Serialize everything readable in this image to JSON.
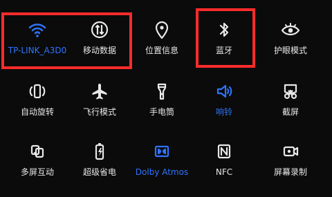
{
  "colors": {
    "background": "#0b0b0b",
    "text": "#e8e8e8",
    "active": "#2f74ff",
    "highlight": "#ff2b2b"
  },
  "tiles": [
    {
      "label": "TP-LINK_A3D0",
      "icon": "wifi-icon",
      "active": true
    },
    {
      "label": "移动数据",
      "icon": "mobile-data-icon",
      "active": false
    },
    {
      "label": "位置信息",
      "icon": "location-icon",
      "active": false
    },
    {
      "label": "蓝牙",
      "icon": "bluetooth-icon",
      "active": false
    },
    {
      "label": "护眼模式",
      "icon": "eye-icon",
      "active": false
    },
    {
      "label": "自动旋转",
      "icon": "auto-rotate-icon",
      "active": false
    },
    {
      "label": "飞行模式",
      "icon": "airplane-icon",
      "active": false
    },
    {
      "label": "手电筒",
      "icon": "flashlight-icon",
      "active": false
    },
    {
      "label": "响铃",
      "icon": "speaker-icon",
      "active": true
    },
    {
      "label": "截屏",
      "icon": "screenshot-icon",
      "active": false
    },
    {
      "label": "多屏互动",
      "icon": "multi-screen-icon",
      "active": false
    },
    {
      "label": "超级省电",
      "icon": "battery-saver-icon",
      "active": false
    },
    {
      "label": "Dolby Atmos",
      "icon": "dolby-icon",
      "active": true
    },
    {
      "label": "NFC",
      "icon": "nfc-icon",
      "active": false
    },
    {
      "label": "屏幕录制",
      "icon": "screen-record-icon",
      "active": false
    }
  ]
}
